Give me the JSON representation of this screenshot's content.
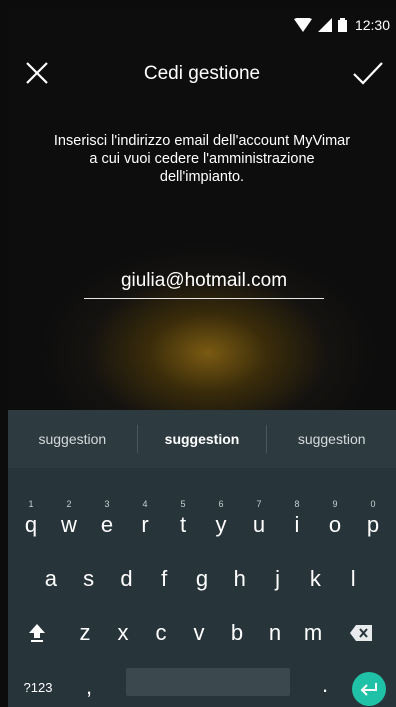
{
  "status_bar": {
    "time": "12:30"
  },
  "header": {
    "title": "Cedi gestione",
    "close_icon": "close-icon",
    "confirm_icon": "check-icon"
  },
  "instruction": {
    "line1": "Inserisci l'indirizzo email dell'account MyVimar",
    "line2": "a cui vuoi cedere l'amministrazione",
    "line3": "dell'impianto."
  },
  "email": {
    "value": "giulia@hotmail.com"
  },
  "keyboard": {
    "suggestions": [
      "suggestion",
      "suggestion",
      "suggestion"
    ],
    "row1": [
      {
        "letter": "q",
        "hint": "1"
      },
      {
        "letter": "w",
        "hint": "2"
      },
      {
        "letter": "e",
        "hint": "3"
      },
      {
        "letter": "r",
        "hint": "4"
      },
      {
        "letter": "t",
        "hint": "5"
      },
      {
        "letter": "y",
        "hint": "6"
      },
      {
        "letter": "u",
        "hint": "7"
      },
      {
        "letter": "i",
        "hint": "8"
      },
      {
        "letter": "o",
        "hint": "9"
      },
      {
        "letter": "p",
        "hint": "0"
      }
    ],
    "row2": [
      "a",
      "s",
      "d",
      "f",
      "g",
      "h",
      "j",
      "k",
      "l"
    ],
    "row3": [
      "z",
      "x",
      "c",
      "v",
      "b",
      "n",
      "m"
    ],
    "sym_label": "?123",
    "comma": ",",
    "period": ".",
    "enter_color": "#20c2a7"
  }
}
